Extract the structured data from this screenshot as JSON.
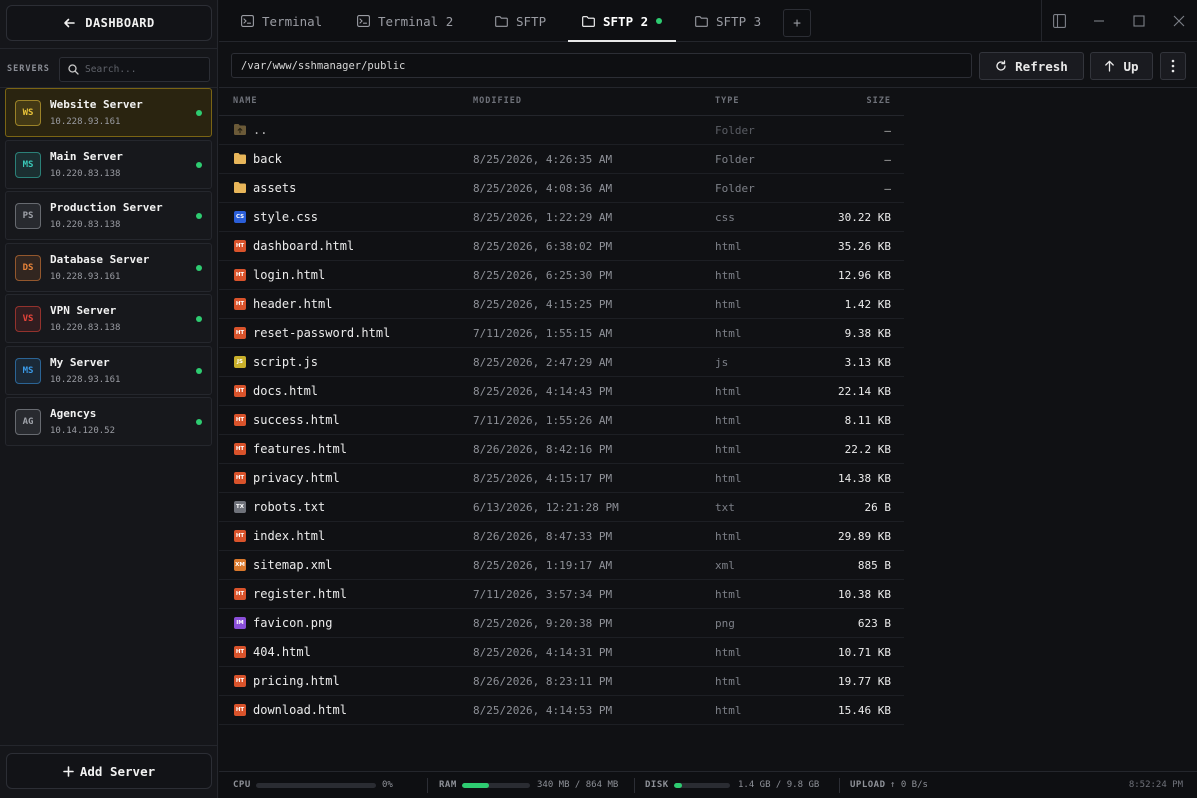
{
  "sidebar": {
    "dashboard_label": "DASHBOARD",
    "servers_label": "SERVERS",
    "search_placeholder": "Search...",
    "add_server_label": "Add Server",
    "servers": [
      {
        "initials": "WS",
        "name": "Website Server",
        "ip": "10.228.93.161",
        "color": "#e8c33a",
        "active": true
      },
      {
        "initials": "MS",
        "name": "Main Server",
        "ip": "10.220.83.138",
        "color": "#3ac9b8",
        "active": false
      },
      {
        "initials": "PS",
        "name": "Production Server",
        "ip": "10.220.83.138",
        "color": "#a0a3aa",
        "active": false
      },
      {
        "initials": "DS",
        "name": "Database Server",
        "ip": "10.228.93.161",
        "color": "#e8843a",
        "active": false
      },
      {
        "initials": "VS",
        "name": "VPN Server",
        "ip": "10.220.83.138",
        "color": "#e8453a",
        "active": false
      },
      {
        "initials": "MS",
        "name": "My Server",
        "ip": "10.228.93.161",
        "color": "#3a9ae8",
        "active": false
      },
      {
        "initials": "AG",
        "name": "Agencys",
        "ip": "10.14.120.52",
        "color": "#a0a3aa",
        "active": false
      }
    ]
  },
  "tabs": [
    {
      "label": "Terminal",
      "icon": "terminal-icon",
      "active": false
    },
    {
      "label": "Terminal 2",
      "icon": "terminal-icon",
      "active": false
    },
    {
      "label": "SFTP",
      "icon": "folder-icon",
      "active": false
    },
    {
      "label": "SFTP 2",
      "icon": "folder-icon",
      "active": true
    },
    {
      "label": "SFTP 3",
      "icon": "folder-icon",
      "active": false
    }
  ],
  "tab_add_label": "+",
  "toolbar": {
    "path": "/var/www/sshmanager/public",
    "refresh_label": "Refresh",
    "up_label": "Up"
  },
  "file_table": {
    "columns": {
      "name": "NAME",
      "modified": "MODIFIED",
      "type": "TYPE",
      "size": "SIZE"
    },
    "rows": [
      {
        "name": "..",
        "modified": "",
        "type": "Folder",
        "size": "—",
        "kind": "parent"
      },
      {
        "name": "back",
        "modified": "8/25/2026, 4:26:35 AM",
        "type": "Folder",
        "size": "—",
        "kind": "folder"
      },
      {
        "name": "assets",
        "modified": "8/25/2026, 4:08:36 AM",
        "type": "Folder",
        "size": "—",
        "kind": "folder"
      },
      {
        "name": "style.css",
        "modified": "8/25/2026, 1:22:29 AM",
        "type": "css",
        "size": "30.22 KB",
        "kind": "css"
      },
      {
        "name": "dashboard.html",
        "modified": "8/25/2026, 6:38:02 PM",
        "type": "html",
        "size": "35.26 KB",
        "kind": "html"
      },
      {
        "name": "login.html",
        "modified": "8/25/2026, 6:25:30 PM",
        "type": "html",
        "size": "12.96 KB",
        "kind": "html"
      },
      {
        "name": "header.html",
        "modified": "8/25/2026, 4:15:25 PM",
        "type": "html",
        "size": "1.42 KB",
        "kind": "html"
      },
      {
        "name": "reset-password.html",
        "modified": "7/11/2026, 1:55:15 AM",
        "type": "html",
        "size": "9.38 KB",
        "kind": "html"
      },
      {
        "name": "script.js",
        "modified": "8/25/2026, 2:47:29 AM",
        "type": "js",
        "size": "3.13 KB",
        "kind": "js"
      },
      {
        "name": "docs.html",
        "modified": "8/25/2026, 4:14:43 PM",
        "type": "html",
        "size": "22.14 KB",
        "kind": "html"
      },
      {
        "name": "success.html",
        "modified": "7/11/2026, 1:55:26 AM",
        "type": "html",
        "size": "8.11 KB",
        "kind": "html"
      },
      {
        "name": "features.html",
        "modified": "8/26/2026, 8:42:16 PM",
        "type": "html",
        "size": "22.2 KB",
        "kind": "html"
      },
      {
        "name": "privacy.html",
        "modified": "8/25/2026, 4:15:17 PM",
        "type": "html",
        "size": "14.38 KB",
        "kind": "html"
      },
      {
        "name": "robots.txt",
        "modified": "6/13/2026, 12:21:28 PM",
        "type": "txt",
        "size": "26 B",
        "kind": "txt"
      },
      {
        "name": "index.html",
        "modified": "8/26/2026, 8:47:33 PM",
        "type": "html",
        "size": "29.89 KB",
        "kind": "html"
      },
      {
        "name": "sitemap.xml",
        "modified": "8/25/2026, 1:19:17 AM",
        "type": "xml",
        "size": "885 B",
        "kind": "xml"
      },
      {
        "name": "register.html",
        "modified": "7/11/2026, 3:57:34 PM",
        "type": "html",
        "size": "10.38 KB",
        "kind": "html"
      },
      {
        "name": "favicon.png",
        "modified": "8/25/2026, 9:20:38 PM",
        "type": "png",
        "size": "623 B",
        "kind": "png"
      },
      {
        "name": "404.html",
        "modified": "8/25/2026, 4:14:31 PM",
        "type": "html",
        "size": "10.71 KB",
        "kind": "html"
      },
      {
        "name": "pricing.html",
        "modified": "8/26/2026, 8:23:11 PM",
        "type": "html",
        "size": "19.77 KB",
        "kind": "html"
      },
      {
        "name": "download.html",
        "modified": "8/25/2026, 4:14:53 PM",
        "type": "html",
        "size": "15.46 KB",
        "kind": "html"
      }
    ]
  },
  "file_badges": {
    "css": {
      "text": "CS",
      "color": "#2b5fd9"
    },
    "html": {
      "text": "HT",
      "color": "#d9532b"
    },
    "js": {
      "text": "JS",
      "color": "#c9b02b"
    },
    "txt": {
      "text": "TX",
      "color": "#6f727a"
    },
    "xml": {
      "text": "XM",
      "color": "#d9782b"
    },
    "png": {
      "text": "IM",
      "color": "#8a4fd9"
    }
  },
  "status": {
    "cpu_label": "CPU",
    "cpu_value": "0%",
    "cpu_fraction": 0.0,
    "ram_label": "RAM",
    "ram_value": "340 MB / 864 MB",
    "ram_fraction": 0.39,
    "disk_label": "DISK",
    "disk_value": "1.4 GB / 9.8 GB",
    "disk_fraction": 0.14,
    "upload_label": "UPLOAD",
    "upload_value": "↑ 0 B/s",
    "clock": "8:52:24 PM"
  },
  "colors": {
    "accent": "#e8c33a",
    "online": "#2ecc71"
  }
}
